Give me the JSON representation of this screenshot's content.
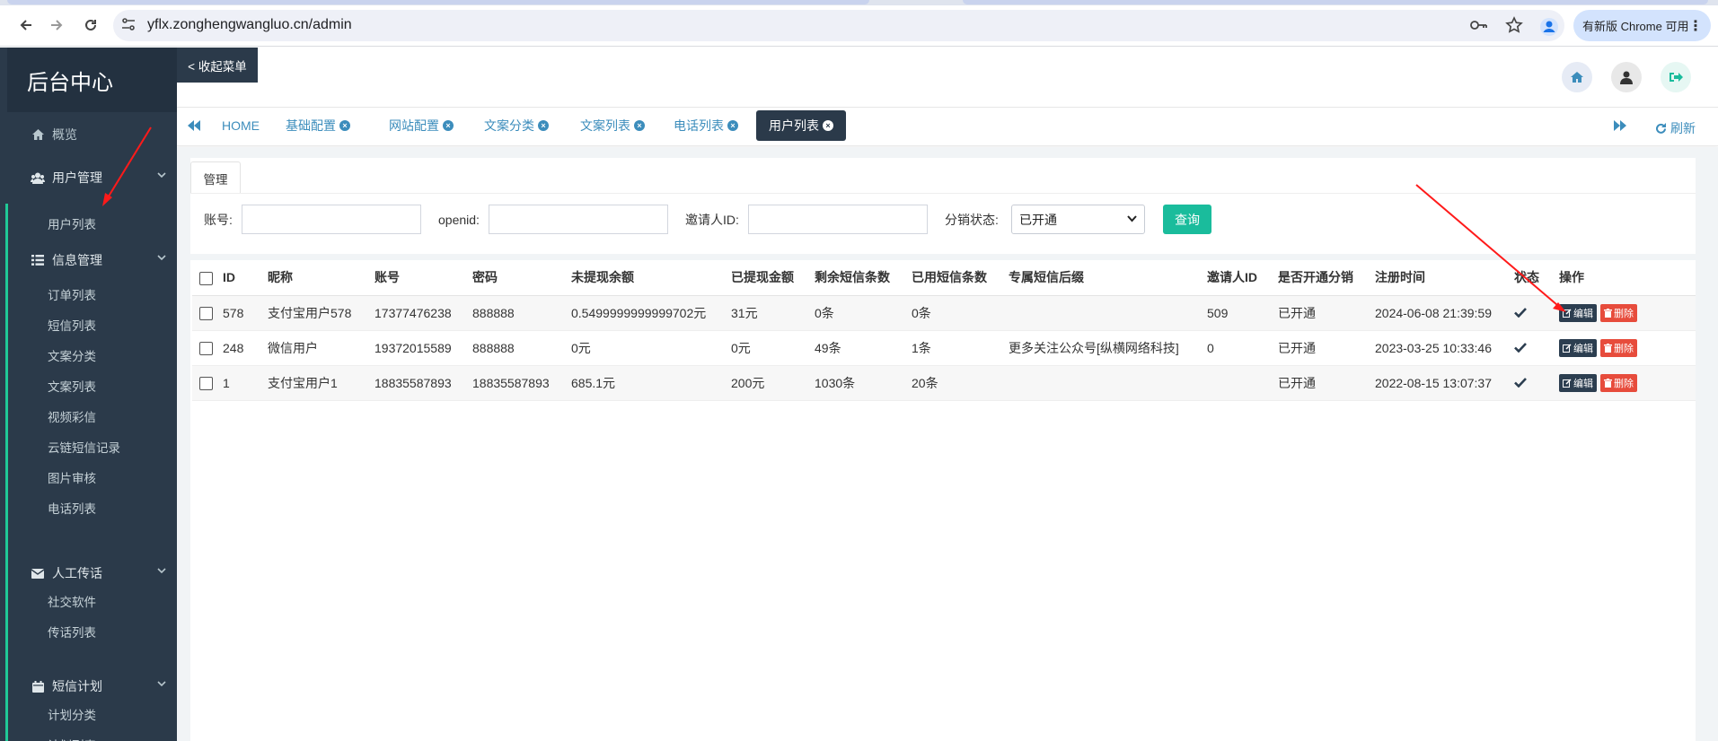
{
  "browser": {
    "url": "yflx.zonghengwangluo.cn/admin",
    "update_label": "有新版 Chrome 可用"
  },
  "sidebar": {
    "logo": "后台中心",
    "overview": "概览",
    "groups": [
      {
        "title": "用户管理",
        "icon": "users-icon",
        "items": [
          "用户列表"
        ]
      },
      {
        "title": "信息管理",
        "icon": "list-icon",
        "items": [
          "订单列表",
          "短信列表",
          "文案分类",
          "文案列表",
          "视频彩信",
          "云链短信记录",
          "图片审核",
          "电话列表"
        ]
      },
      {
        "title": "人工传话",
        "icon": "envelope-icon",
        "items": [
          "社交软件",
          "传话列表"
        ]
      },
      {
        "title": "短信计划",
        "icon": "calendar-icon",
        "items": [
          "计划分类",
          "计划列表"
        ]
      }
    ]
  },
  "topbar": {
    "collapse_label": "< 收起菜单"
  },
  "tabs": [
    {
      "label": "HOME",
      "closable": false,
      "active": false
    },
    {
      "label": "基础配置",
      "closable": true,
      "active": false
    },
    {
      "label": "网站配置",
      "closable": true,
      "active": false
    },
    {
      "label": "文案分类",
      "closable": true,
      "active": false
    },
    {
      "label": "文案列表",
      "closable": true,
      "active": false
    },
    {
      "label": "电话列表",
      "closable": true,
      "active": false
    },
    {
      "label": "用户列表",
      "closable": true,
      "active": true
    }
  ],
  "refresh_label": "刷新",
  "panel_tab": "管理",
  "filters": {
    "account_label": "账号:",
    "openid_label": "openid:",
    "inviter_label": "邀请人ID:",
    "distribution_label": "分销状态:",
    "distribution_value": "已开通",
    "search_button": "查询"
  },
  "table": {
    "headers": [
      "ID",
      "昵称",
      "账号",
      "密码",
      "未提现余额",
      "已提现金额",
      "剩余短信条数",
      "已用短信条数",
      "专属短信后缀",
      "邀请人ID",
      "是否开通分销",
      "注册时间",
      "状态",
      "操作"
    ],
    "rows": [
      [
        "578",
        "支付宝用户578",
        "17377476238",
        "888888",
        "0.5499999999999702元",
        "31元",
        "0条",
        "0条",
        "",
        "509",
        "已开通",
        "2024-06-08 21:39:59"
      ],
      [
        "248",
        "微信用户",
        "19372015589",
        "888888",
        "0元",
        "0元",
        "49条",
        "1条",
        "更多关注公众号[纵横网络科技]",
        "0",
        "已开通",
        "2023-03-25 10:33:46"
      ],
      [
        "1",
        "支付宝用户1",
        "18835587893",
        "18835587893",
        "685.1元",
        "200元",
        "1030条",
        "20条",
        "",
        "",
        "已开通",
        "2022-08-15 13:07:37"
      ]
    ],
    "edit_label": "编辑",
    "delete_label": "删除"
  },
  "colors": {
    "sidebar": "#2b3a4a",
    "accent": "#1abc9c",
    "link": "#3c8dbc",
    "danger": "#e74c3c",
    "annotation_arrow": "#ff1a1a"
  }
}
